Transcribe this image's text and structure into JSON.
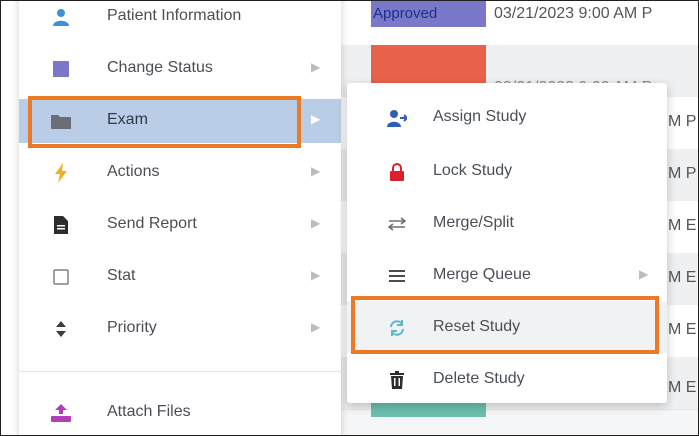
{
  "colors": {
    "highlight_outline": "#ec7a25",
    "active_row": "#b9cde6",
    "status_purple": "#7a78c8",
    "status_red": "#e8624a",
    "status_teal": "#6bbfae"
  },
  "background_table": {
    "rows": [
      {
        "status": "Approved",
        "datetime": "03/21/2023 9:00 AM P"
      },
      {
        "status": "",
        "datetime": "03/21/2023 9:00 AM P"
      },
      {
        "status": "",
        "datetime": "M P"
      },
      {
        "status": "",
        "datetime": "M P"
      },
      {
        "status": "",
        "datetime": "M E"
      },
      {
        "status": "",
        "datetime": "M E"
      },
      {
        "status": "",
        "datetime": "M E"
      },
      {
        "status": "",
        "datetime": "M E"
      }
    ]
  },
  "context_menu": {
    "items": [
      {
        "label": "Patient Information",
        "icon": "person-icon",
        "has_submenu": false
      },
      {
        "label": "Change Status",
        "icon": "square-icon",
        "has_submenu": true
      },
      {
        "label": "Exam",
        "icon": "folder-icon",
        "has_submenu": true,
        "active": true
      },
      {
        "label": "Actions",
        "icon": "bolt-icon",
        "has_submenu": true
      },
      {
        "label": "Send Report",
        "icon": "document-icon",
        "has_submenu": true
      },
      {
        "label": "Stat",
        "icon": "checkbox-icon",
        "has_submenu": true
      },
      {
        "label": "Priority",
        "icon": "sort-icon",
        "has_submenu": true
      },
      {
        "label": "Attach Files",
        "icon": "upload-person-icon",
        "has_submenu": false
      }
    ]
  },
  "exam_submenu": {
    "items": [
      {
        "label": "Assign Study",
        "icon": "assign-user-icon"
      },
      {
        "label": "Lock Study",
        "icon": "lock-icon"
      },
      {
        "label": "Merge/Split",
        "icon": "arrows-icon"
      },
      {
        "label": "Merge Queue",
        "icon": "list-icon",
        "has_submenu": true
      },
      {
        "label": "Reset Study",
        "icon": "refresh-icon",
        "hover": true
      },
      {
        "label": "Delete Study",
        "icon": "trash-icon"
      }
    ]
  }
}
